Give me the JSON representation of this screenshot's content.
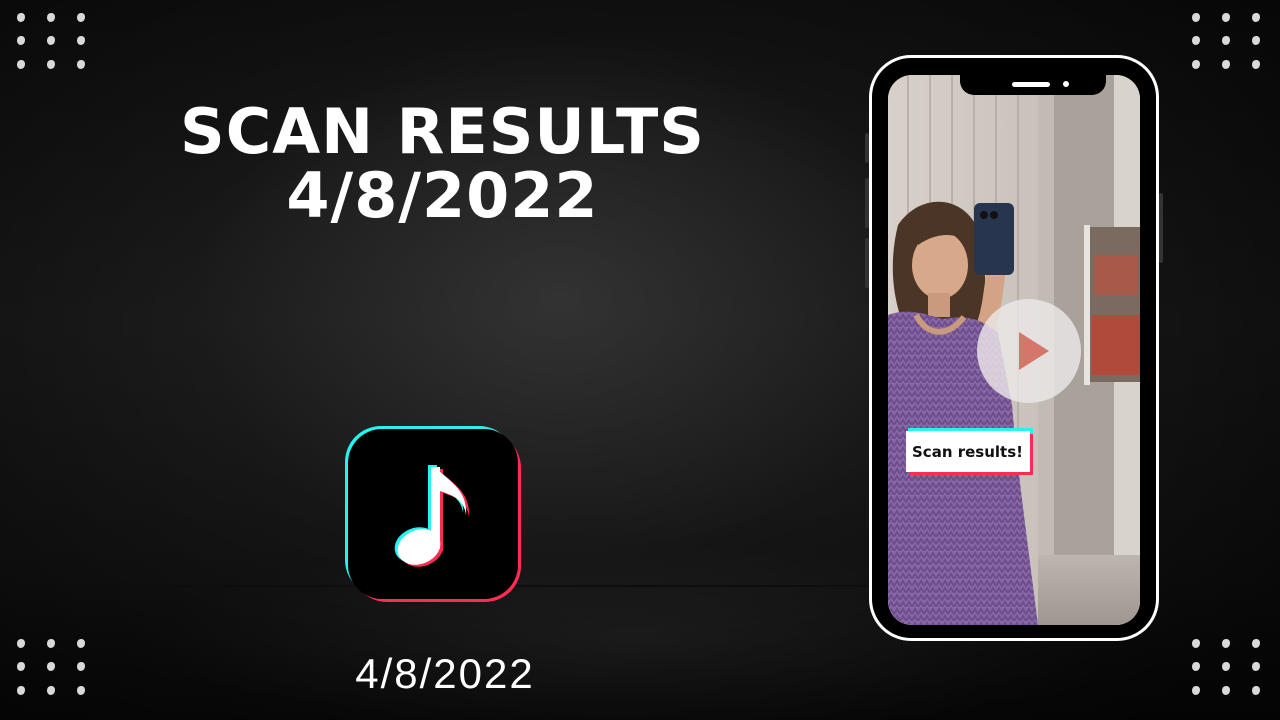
{
  "title": {
    "line1": "SCAN RESULTS",
    "line2": "4/8/2022"
  },
  "app_icon": {
    "icon": "tiktok-music-note-icon",
    "colors": {
      "background": "#000000",
      "cyan": "#25f4ee",
      "red": "#fe2c55"
    }
  },
  "date_label": "4/8/2022",
  "phone": {
    "video_caption": "Scan results!",
    "play_icon": "play-icon"
  },
  "decor": {
    "dot_color": "#d9d9d9"
  }
}
